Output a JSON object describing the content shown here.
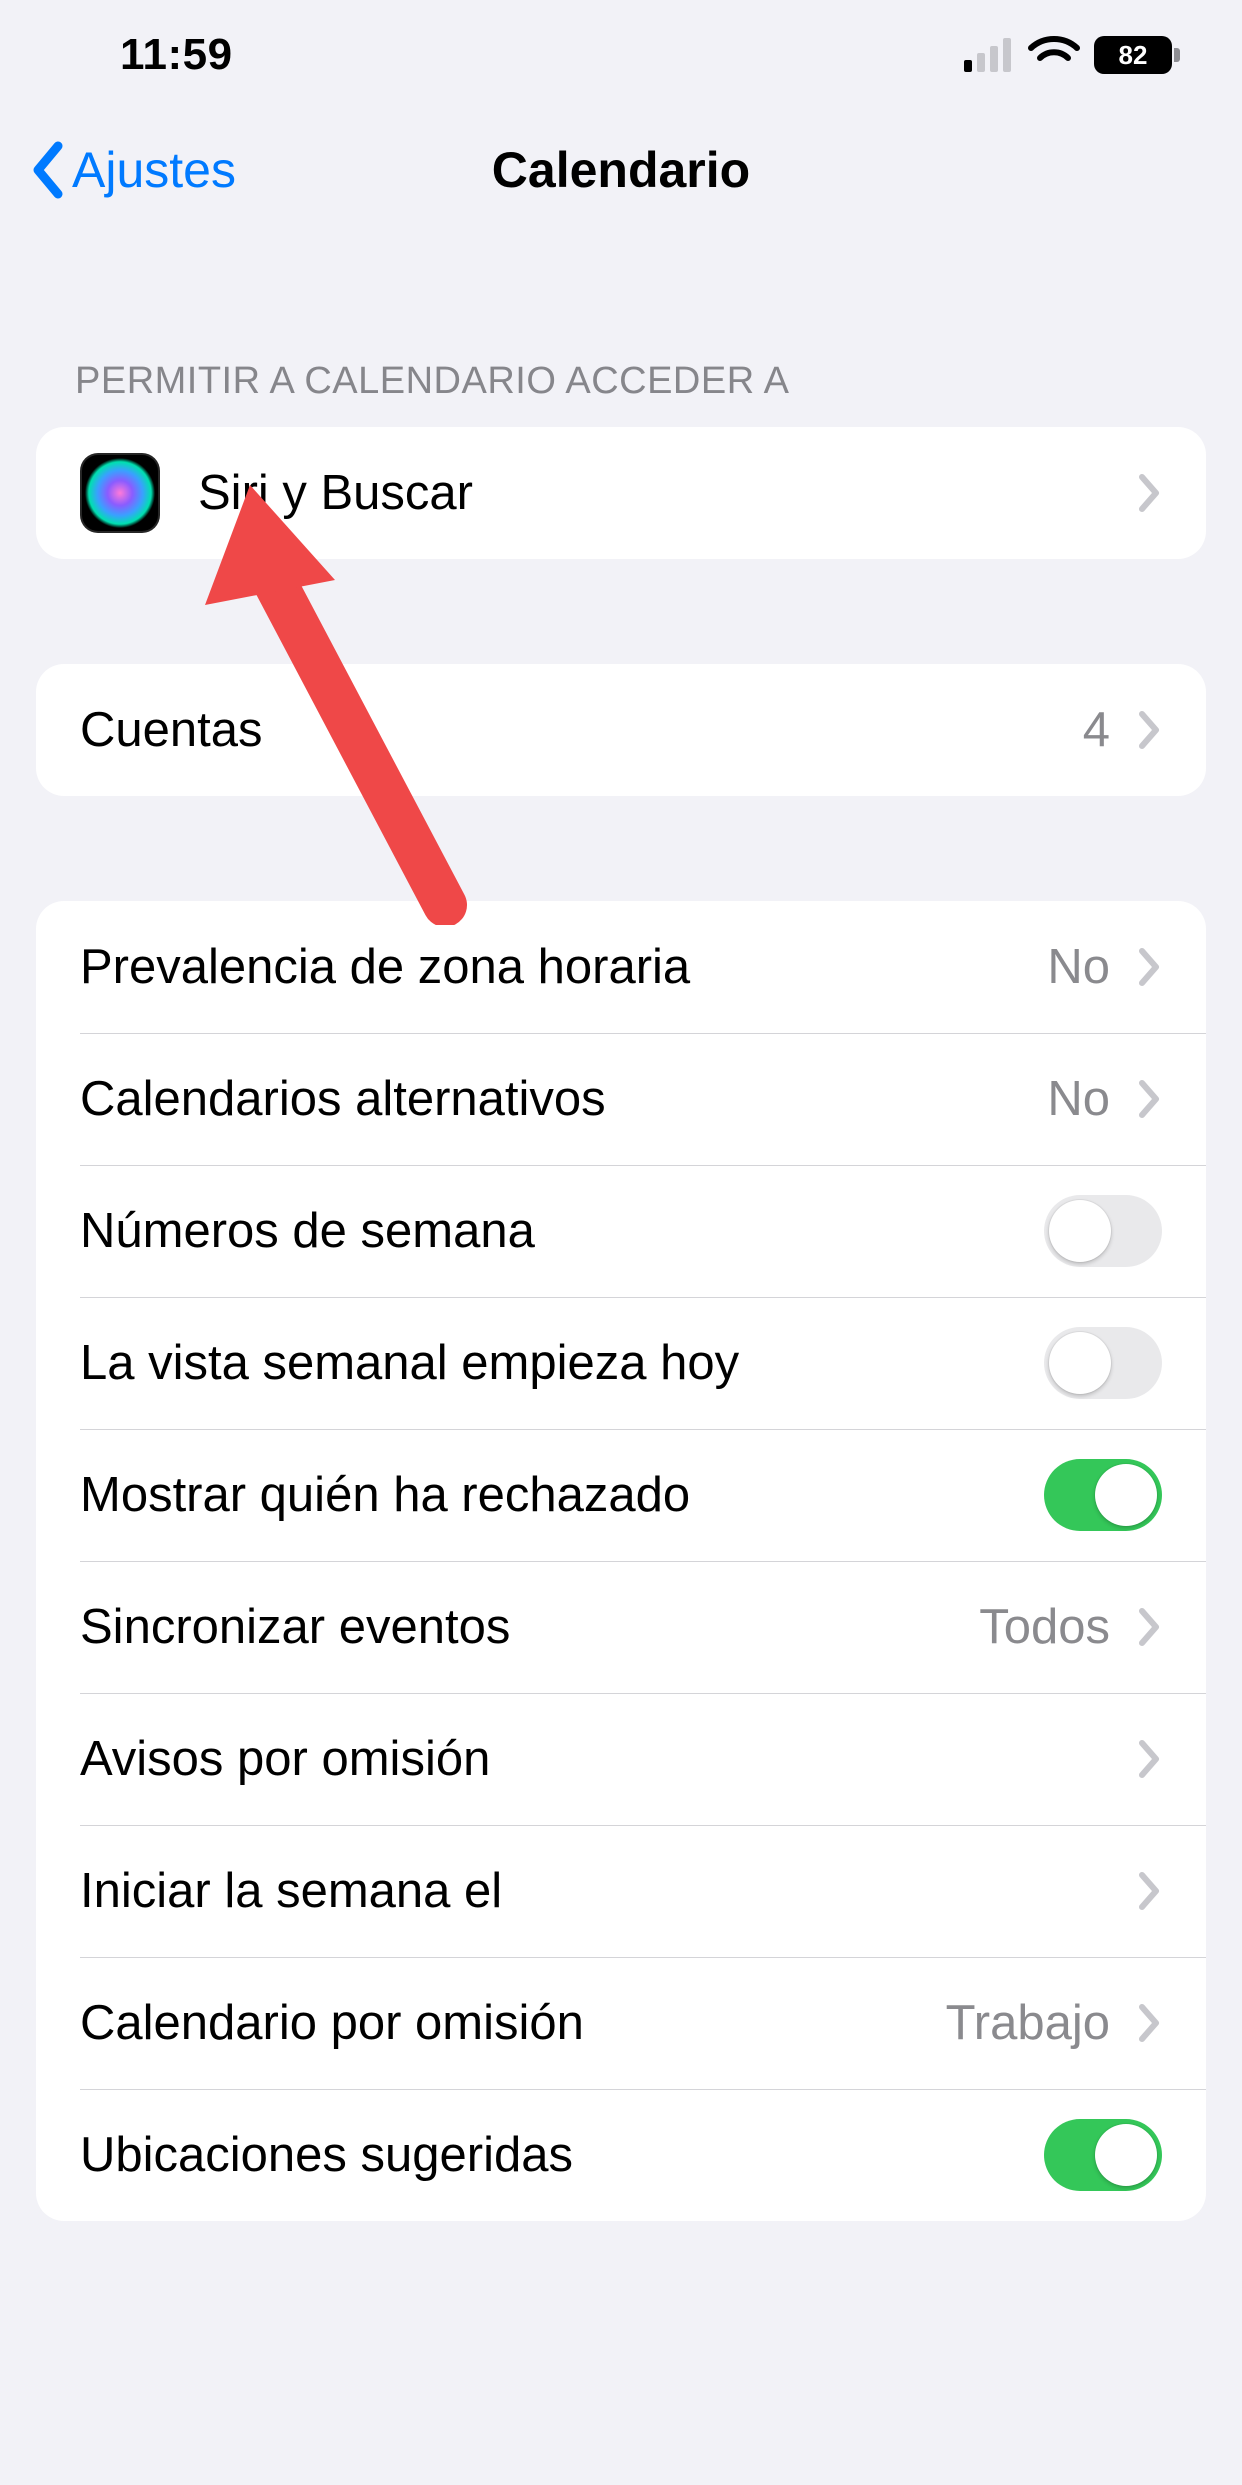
{
  "status": {
    "time": "11:59",
    "battery_percent": "82"
  },
  "nav": {
    "back_label": "Ajustes",
    "title": "Calendario"
  },
  "section_access": {
    "header": "PERMITIR A CALENDARIO ACCEDER A",
    "siri_label": "Siri y Buscar"
  },
  "accounts": {
    "label": "Cuentas",
    "count": "4"
  },
  "settings": {
    "timezone_override": {
      "label": "Prevalencia de zona horaria",
      "value": "No"
    },
    "alt_calendars": {
      "label": "Calendarios alternativos",
      "value": "No"
    },
    "week_numbers": {
      "label": "Números de semana",
      "on": false
    },
    "week_view_starts_today": {
      "label": "La vista semanal empieza hoy",
      "on": false
    },
    "show_declined": {
      "label": "Mostrar quién ha rechazado",
      "on": true
    },
    "sync_events": {
      "label": "Sincronizar eventos",
      "value": "Todos"
    },
    "default_alerts": {
      "label": "Avisos por omisión"
    },
    "week_starts_on": {
      "label": "Iniciar la semana el"
    },
    "default_calendar": {
      "label": "Calendario por omisión",
      "value": "Trabajo"
    },
    "suggested_locations": {
      "label": "Ubicaciones sugeridas",
      "on": true
    }
  }
}
